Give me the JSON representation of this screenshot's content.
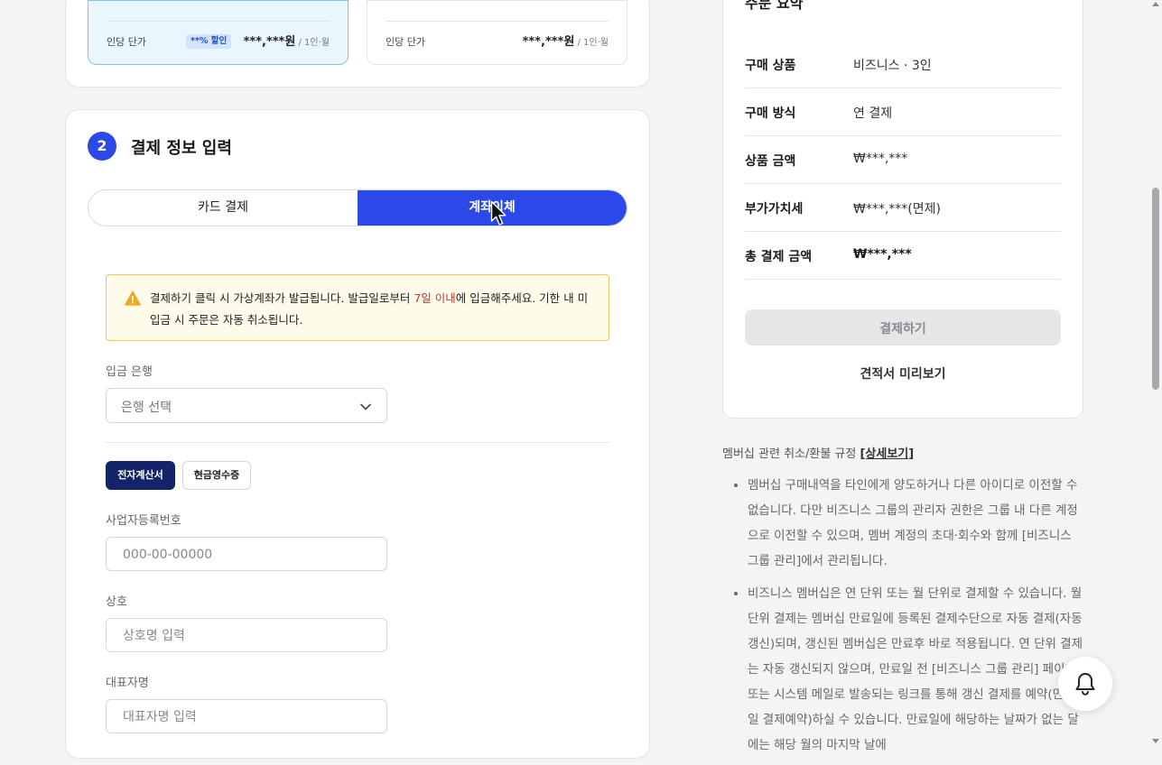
{
  "plans": [
    {
      "unit_price_label": "인당 단가",
      "badge": "**% 할인",
      "price": "***,***원",
      "unit": " / 1인·월",
      "selected": true
    },
    {
      "unit_price_label": "인당 단가",
      "price": "***,***원",
      "unit": " / 1인·월",
      "selected": false
    }
  ],
  "payment": {
    "step_number": "2",
    "title": "결제 정보 입력",
    "methods": {
      "card": "카드 결제",
      "bank": "계좌이체"
    },
    "notice": {
      "before": "결제하기 클릭 시 가상계좌가 발급됩니다. 발급일로부터 ",
      "highlight": "7일 이내",
      "after": "에 입금해주세요. 기한 내 미입금 시 주문은 자동 취소됩니다."
    },
    "bank_label": "입금 은행",
    "bank_placeholder": "은행 선택",
    "receipt_types": {
      "tax_invoice": "전자계산서",
      "cash_receipt": "현금영수증"
    },
    "fields": [
      {
        "label": "사업자등록번호",
        "placeholder": "000-00-00000"
      },
      {
        "label": "상호",
        "placeholder": "상호명 입력"
      },
      {
        "label": "대표자명",
        "placeholder": "대표자명 입력"
      }
    ]
  },
  "summary": {
    "title": "주문 요약",
    "rows": [
      {
        "key": "구매 상품",
        "value": "비즈니스 · 3인"
      },
      {
        "key": "구매 방식",
        "value": "연 결제"
      },
      {
        "key": "상품 금액",
        "value": "₩***,***"
      },
      {
        "key": "부가가치세",
        "value": "₩***,***(면제)"
      },
      {
        "key": "총 결제 금액",
        "value": "₩***,***"
      }
    ],
    "pay_button": "결제하기",
    "quote_link": "견적서 미리보기"
  },
  "policy": {
    "heading": "멤버십 관련 취소/환불 규정 ",
    "detail_link": "[상세보기]",
    "items": [
      "멤버십 구매내역을 타인에게 양도하거나 다른 아이디로 이전할 수 없습니다. 다만 비즈니스 그룹의 관리자 권한은 그룹 내 다른 계정으로 이전할 수 있으며, 멤버 계정의 초대·회수와 함께 [비즈니스 그룹 관리]에서 관리됩니다.",
      "비즈니스 멤버십은 연 단위 또는 월 단위로 결제할 수 있습니다. 월 단위 결제는 멤버십 만료일에 등록된 결제수단으로 자동 결제(자동갱신)되며, 갱신된 멤버십은 만료후 바로 적용됩니다. 연 단위 결제는 자동 갱신되지 않으며, 만료일 전 [비즈니스 그룹 관리] 페이지 또는 시스템 메일로 발송되는 링크를 통해 갱신 결제를 예약(만료일 결제예약)하실 수 있습니다. 만료일에 해당하는 날짜가 없는 달에는 해당 월의 마지막 날에"
    ]
  },
  "colors": {
    "accent": "#2b48e8",
    "navy": "#13246b",
    "warning": "#f1c65b"
  }
}
